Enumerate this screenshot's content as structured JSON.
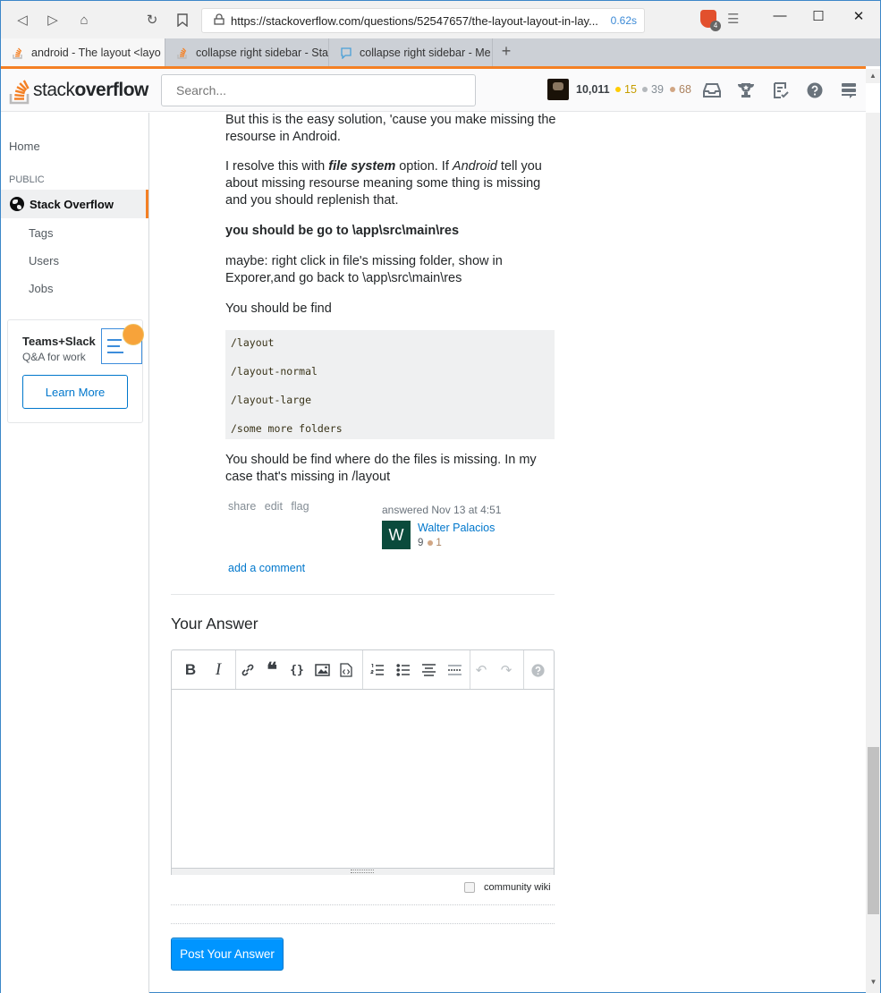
{
  "browser": {
    "url": "https://stackoverflow.com/questions/52547657/the-layout-layout-in-lay...",
    "load_time": "0.62s",
    "brave_badge_count": "4",
    "tabs": [
      {
        "label": "android - The layout <layo",
        "active": true,
        "icon": "stackoverflow-icon"
      },
      {
        "label": "collapse right sidebar - Sta",
        "active": false,
        "icon": "stackoverflow-icon"
      },
      {
        "label": "collapse right sidebar - Me",
        "active": false,
        "icon": "meta-chat-icon"
      }
    ],
    "new_tab_label": "+"
  },
  "header": {
    "logo_text_light": "stack",
    "logo_text_bold": "overflow",
    "search_placeholder": "Search...",
    "reputation": "10,011",
    "badges": {
      "gold": "15",
      "silver": "39",
      "bronze": "68"
    },
    "colors": {
      "gold": "#ffcc01",
      "silver": "#b4b8bc",
      "bronze": "#d1a684",
      "accent": "#f48024"
    }
  },
  "sidebar": {
    "home": "Home",
    "section_heading": "PUBLIC",
    "active_item": "Stack Overflow",
    "items": [
      "Tags",
      "Users",
      "Jobs"
    ],
    "teams": {
      "title": "Teams+Slack",
      "subtitle": "Q&A for work",
      "button": "Learn More"
    }
  },
  "answer": {
    "p1": "But this is the easy solution, 'cause you make missing the resourse in Android.",
    "p2_pre": "I resolve this with ",
    "p2_bold": "file system",
    "p2_mid": " option. If ",
    "p2_italic": "Android",
    "p2_post": " tell you about missing resourse meaning some thing is missing and you should replenish that.",
    "p3_bold": "you should be go to \\app\\src\\main\\res",
    "p4": "maybe: right click in file's missing folder, show in Exporer,and go back to \\app\\src\\main\\res",
    "p5": "You should be find",
    "code_lines": [
      "/layout",
      "/layout-normal",
      "/layout-large",
      "/some more folders"
    ],
    "p6": "You should be find where do the files is missing. In my case that's missing in /layout",
    "menu": [
      "share",
      "edit",
      "flag"
    ],
    "answered_time": "answered Nov 13 at 4:51",
    "author": {
      "initial": "W",
      "name": "Walter Palacios",
      "rep": "9",
      "bronze": "1"
    },
    "add_comment": "add a comment"
  },
  "compose": {
    "heading": "Your Answer",
    "toolbar": [
      "bold",
      "italic",
      "link",
      "blockquote",
      "code",
      "image",
      "snippet",
      "ordered-list",
      "unordered-list",
      "heading",
      "horizontal-rule",
      "undo",
      "redo",
      "help"
    ],
    "community_wiki_label": "community wiki",
    "community_wiki_checked": false,
    "submit_label": "Post Your Answer"
  }
}
